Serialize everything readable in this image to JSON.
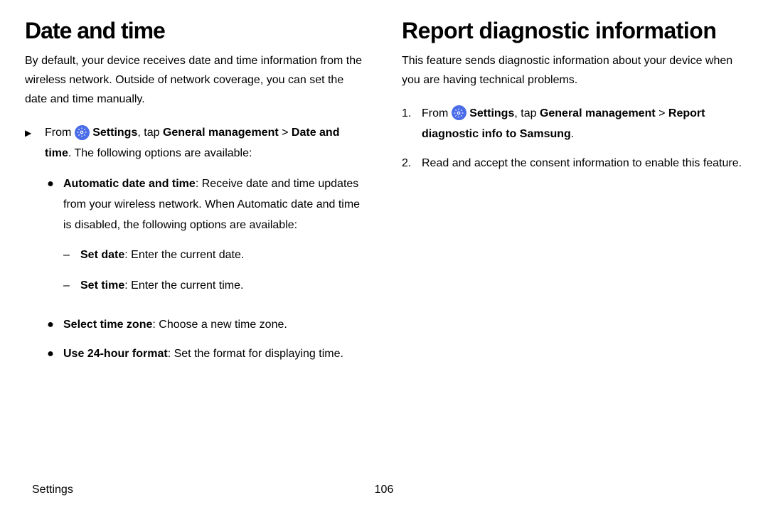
{
  "left": {
    "heading": "Date and time",
    "intro": "By default, your device receives date and time information from the wireless network. Outside of network coverage, you can set the date and time manually.",
    "step_from": "From ",
    "settings_label": "Settings",
    "tap_label": ", tap ",
    "general_mgmt": "General management",
    "chevron": " > ",
    "date_time_bold": "Date and time",
    "tail": ". The following options are available:",
    "auto_dt_label": "Automatic date and time",
    "auto_dt_desc": ": Receive date and time updates from your wireless network. When Automatic date and time is disabled, the following options are available:",
    "set_date_label": "Set date",
    "set_date_desc": ": Enter the current date.",
    "set_time_label": "Set time",
    "set_time_desc": ": Enter the current time.",
    "tz_label": "Select time zone",
    "tz_desc": ": Choose a new time zone.",
    "fmt24_label": "Use 24-hour format",
    "fmt24_desc": ": Set the format for displaying time."
  },
  "right": {
    "heading": "Report diagnostic information",
    "intro": "This feature sends diagnostic information about your device when you are having technical problems.",
    "step1_num": "1.",
    "step1_from": "From ",
    "settings_label": "Settings",
    "tap_label": ", tap ",
    "general_mgmt": "General management",
    "chevron": " > ",
    "report_bold": "Report diagnostic info to Samsung",
    "tail": ".",
    "step2_num": "2.",
    "step2_text": "Read and accept the consent information to enable this feature."
  },
  "footer": {
    "section": "Settings",
    "page": "106"
  }
}
